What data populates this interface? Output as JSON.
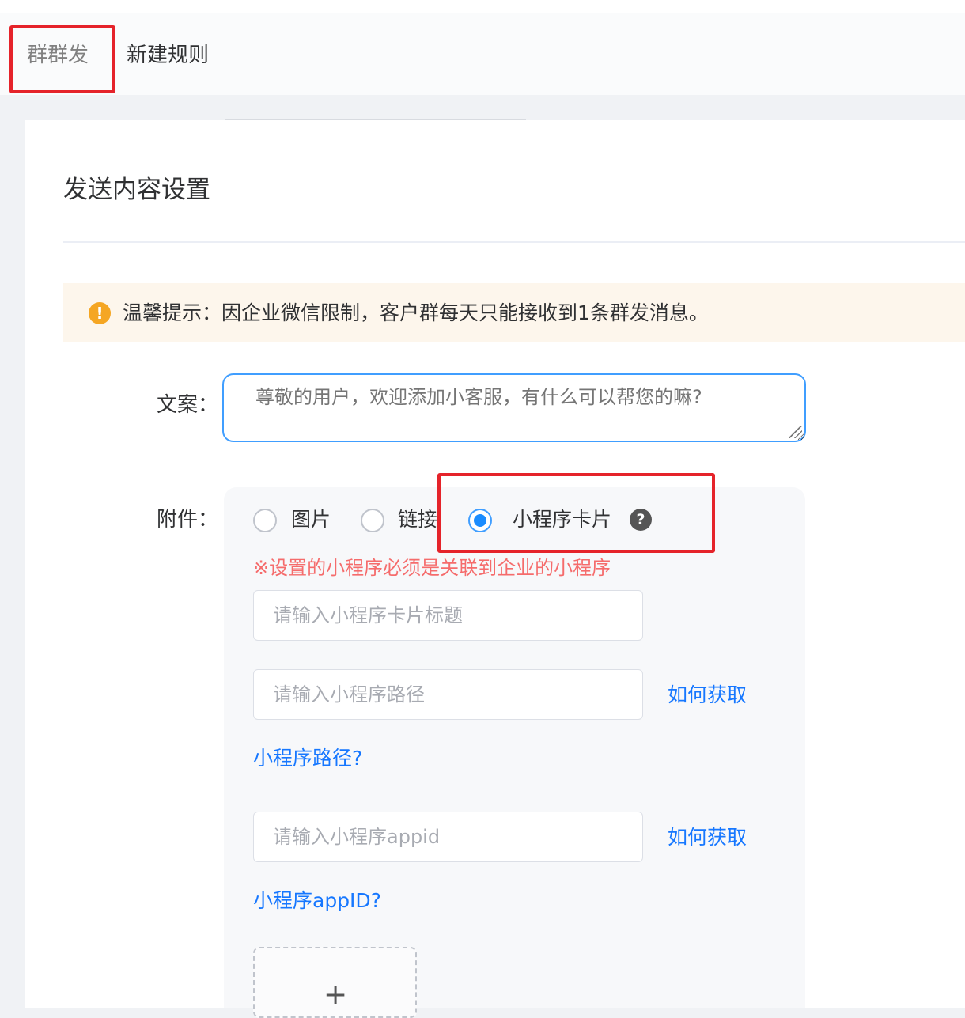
{
  "breadcrumb": {
    "items": [
      "群群发",
      "新建规则"
    ]
  },
  "section": {
    "title": "发送内容设置"
  },
  "tip": {
    "icon": "exclamation-icon",
    "icon_glyph": "!",
    "text": "温馨提示：因企业微信限制，客户群每天只能接收到1条群发消息。"
  },
  "copy": {
    "label": "文案：",
    "placeholder": "尊敬的用户，欢迎添加小客服，有什么可以帮您的嘛?"
  },
  "attachment": {
    "label": "附件：",
    "options": [
      {
        "label": "图片",
        "checked": false
      },
      {
        "label": "链接",
        "checked": false
      },
      {
        "label": "小程序卡片",
        "checked": true
      }
    ],
    "help_glyph": "?",
    "warning": "※设置的小程序必须是关联到企业的小程序",
    "title_placeholder": "请输入小程序卡片标题",
    "path_placeholder": "请输入小程序路径",
    "path_help_link": "如何获取",
    "path_question": "小程序路径?",
    "appid_placeholder": "请输入小程序appid",
    "appid_help_link": "如何获取",
    "appid_question": "小程序appID?",
    "upload_glyph": "+"
  },
  "colors": {
    "primary": "#409eff",
    "link": "#1677ff",
    "warning": "#f56c6c",
    "tip_bg": "#fdf6ec",
    "annotation_red": "#e5232a"
  }
}
